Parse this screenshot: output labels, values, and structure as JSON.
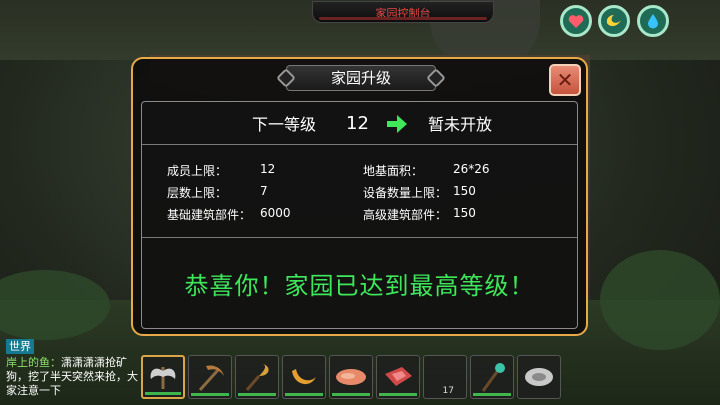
{
  "top_bar": {
    "title": "家园控制台"
  },
  "status_icons": [
    {
      "name": "heart-icon",
      "color": "#ff5c6c"
    },
    {
      "name": "stomach-icon",
      "color": "#ffd23a"
    },
    {
      "name": "water-drop-icon",
      "color": "#37c3ff"
    }
  ],
  "dialog": {
    "title": "家园升级",
    "close_label": "✕",
    "level": {
      "next_label": "下一等级",
      "value": "12",
      "status": "暂未开放"
    },
    "stats_left": [
      {
        "label": "成员上限：",
        "value": "12"
      },
      {
        "label": "层数上限：",
        "value": "7"
      },
      {
        "label": "基础建筑部件：",
        "value": "6000"
      }
    ],
    "stats_right": [
      {
        "label": "地基面积：",
        "value": "26*26"
      },
      {
        "label": "设备数量上限：",
        "value": "150"
      },
      {
        "label": "高级建筑部件：",
        "value": "150"
      }
    ],
    "congrats": "恭喜你！家园已达到最高等级！"
  },
  "chat": {
    "channel": "世界",
    "sender": "岸上的鱼：",
    "message": "潇潇潇潇抢矿狗，挖了半天突然来抢，大家注意一下"
  },
  "hotbar": {
    "slots": [
      {
        "item": "double-axe-icon",
        "color": "#cfcfcf",
        "selected": true
      },
      {
        "item": "pickaxe-icon",
        "color": "#b57a3c"
      },
      {
        "item": "sickle-icon",
        "color": "#d7a23a"
      },
      {
        "item": "banana-icon",
        "color": "#e3a030"
      },
      {
        "item": "meat-icon",
        "color": "#e88a6a"
      },
      {
        "item": "raw-meat-icon",
        "color": "#d04a4a"
      },
      {
        "item": "empty-slot",
        "color": "#000000",
        "count": "17"
      },
      {
        "item": "staff-icon",
        "color": "#3bc4a8"
      },
      {
        "item": "disc-icon",
        "color": "#c9c9c9"
      }
    ]
  }
}
